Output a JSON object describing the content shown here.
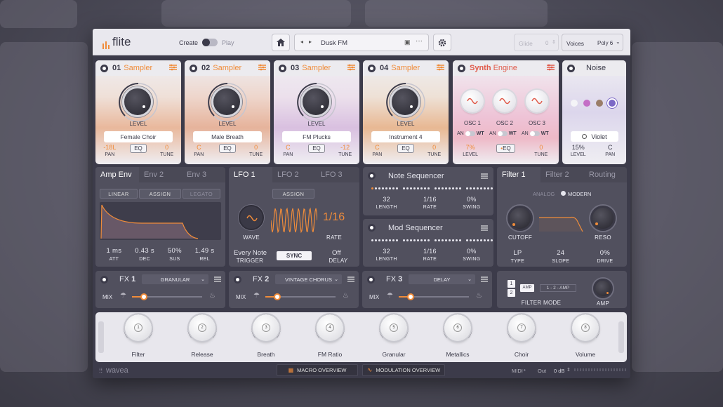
{
  "header": {
    "logo": "flite",
    "create_label": "Create",
    "play_label": "Play",
    "preset_name": "Dusk FM",
    "glide_label": "Glide",
    "glide_value": "0",
    "voices_label": "Voices",
    "voices_value": "Poly 6"
  },
  "layers": [
    {
      "num": "01",
      "type": "Sampler",
      "sample": "Female Choir",
      "level_label": "LEVEL",
      "pan": "-18L",
      "tune": "0",
      "pan_label": "PAN",
      "tune_label": "TUNE",
      "eq": "EQ"
    },
    {
      "num": "02",
      "type": "Sampler",
      "sample": "Male Breath",
      "level_label": "LEVEL",
      "pan": "C",
      "tune": "0",
      "pan_label": "PAN",
      "tune_label": "TUNE",
      "eq": "EQ"
    },
    {
      "num": "03",
      "type": "Sampler",
      "sample": "FM Plucks",
      "level_label": "LEVEL",
      "pan": "C",
      "tune": "-12",
      "pan_label": "PAN",
      "tune_label": "TUNE",
      "eq": "EQ"
    },
    {
      "num": "04",
      "type": "Sampler",
      "sample": "Instrument 4",
      "level_label": "LEVEL",
      "pan": "C",
      "tune": "0",
      "pan_label": "PAN",
      "tune_label": "TUNE",
      "eq": "EQ"
    }
  ],
  "synth": {
    "title_a": "Synth",
    "title_b": "Engine",
    "osc": [
      "OSC 1",
      "OSC 2",
      "OSC 3"
    ],
    "an": "AN",
    "wt": "WT",
    "level": "7%",
    "level_label": "LEVEL",
    "tune": "0",
    "tune_label": "TUNE",
    "eq": "EQ"
  },
  "noise": {
    "title": "Noise",
    "color_name": "Violet",
    "level": "15%",
    "pan": "C",
    "level_label": "LEVEL",
    "pan_label": "PAN",
    "colors": [
      "#f4f4f7",
      "#c46ec6",
      "#9a7d68",
      "#7c69c6"
    ]
  },
  "env": {
    "tabs": [
      "Amp Env",
      "Env 2",
      "Env 3"
    ],
    "buttons": [
      "LINEAR",
      "ASSIGN",
      "LEGATO"
    ],
    "params": [
      {
        "v": "1 ms",
        "l": "ATT"
      },
      {
        "v": "0.43 s",
        "l": "DEC"
      },
      {
        "v": "50%",
        "l": "SUS"
      },
      {
        "v": "1.49 s",
        "l": "REL"
      }
    ]
  },
  "lfo": {
    "tabs": [
      "LFO 1",
      "LFO 2",
      "LFO 3"
    ],
    "assign": "ASSIGN",
    "wave_label": "WAVE",
    "rate_value": "1/16",
    "rate_label": "RATE",
    "trigger_value": "Every Note",
    "trigger_label": "TRIGGER",
    "sync": "SYNC",
    "delay_value": "Off",
    "delay_label": "DELAY"
  },
  "note_seq": {
    "title": "Note Sequencer",
    "length": "32",
    "rate": "1/16",
    "swing": "0%",
    "length_label": "LENGTH",
    "rate_label": "RATE",
    "swing_label": "SWING"
  },
  "mod_seq": {
    "title": "Mod Sequencer",
    "length": "32",
    "rate": "1/16",
    "swing": "0%",
    "length_label": "LENGTH",
    "rate_label": "RATE",
    "swing_label": "SWING"
  },
  "filter": {
    "tabs": [
      "Filter 1",
      "Filter 2",
      "Routing"
    ],
    "analog": "ANALOG",
    "modern": "MODERN",
    "cutoff_label": "CUTOFF",
    "reso_label": "RESO",
    "type": "LP",
    "type_label": "TYPE",
    "slope": "24",
    "slope_label": "SLOPE",
    "drive": "0%",
    "drive_label": "DRIVE",
    "mode_label": "FILTER MODE",
    "amp_label": "AMP",
    "route_1": "1",
    "route_2": "2",
    "route_amp": "AMP",
    "route_seq": "1 - 2 - AMP"
  },
  "fx": [
    {
      "name": "FX",
      "num": "1",
      "type": "GRANULAR",
      "mix": "MIX"
    },
    {
      "name": "FX",
      "num": "2",
      "type": "VINTAGE CHORUS",
      "mix": "MIX"
    },
    {
      "name": "FX",
      "num": "3",
      "type": "DELAY",
      "mix": "MIX"
    }
  ],
  "macros": [
    {
      "n": "1",
      "label": "Filter"
    },
    {
      "n": "2",
      "label": "Release"
    },
    {
      "n": "3",
      "label": "Breath"
    },
    {
      "n": "4",
      "label": "FM Ratio"
    },
    {
      "n": "5",
      "label": "Granular"
    },
    {
      "n": "6",
      "label": "Metallics"
    },
    {
      "n": "7",
      "label": "Choir"
    },
    {
      "n": "8",
      "label": "Volume"
    }
  ],
  "footer": {
    "brand": "wavea",
    "macro_overview": "MACRO OVERVIEW",
    "mod_overview": "MODULATION OVERVIEW",
    "midi": "MIDI",
    "out_label": "Out",
    "out_value": "0 dB"
  }
}
